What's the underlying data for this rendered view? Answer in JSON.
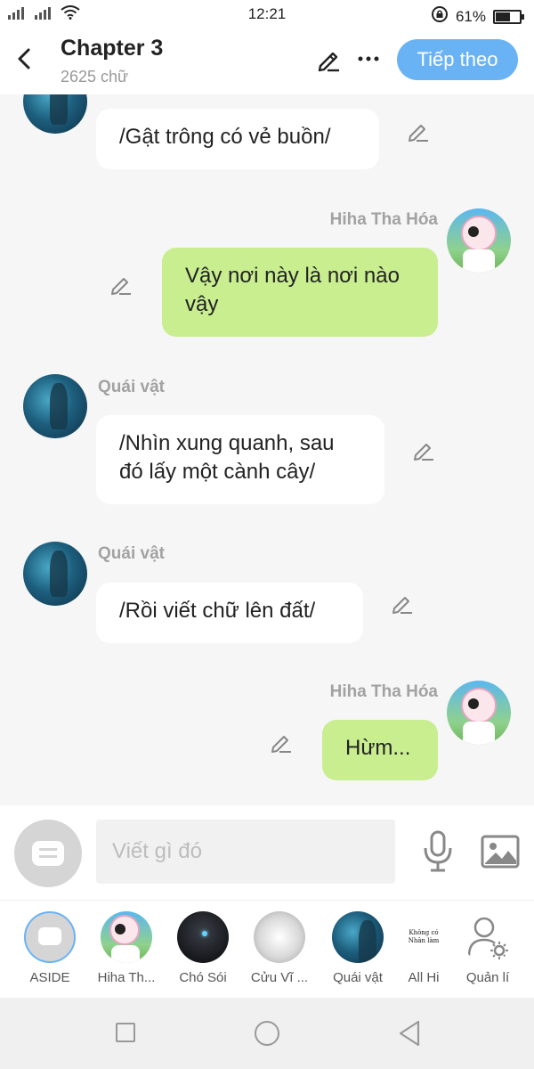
{
  "status": {
    "time": "12:21",
    "battery_text": "61%",
    "battery_level": 0.61,
    "left_icons": [
      "signal-icon",
      "signal-icon",
      "wifi-icon"
    ],
    "right_icons": [
      "rotation-lock-icon",
      "battery-icon"
    ]
  },
  "header": {
    "title": "Chapter 3",
    "subtitle": "2625 chữ",
    "next_label": "Tiếp theo",
    "icons": [
      "back-arrow-icon",
      "pencil-icon",
      "more-icon"
    ]
  },
  "messages": [
    {
      "side": "left",
      "speaker": "",
      "avatar": "monster-avatar",
      "text": "/Gật trông có vẻ buồn/"
    },
    {
      "side": "right",
      "speaker": "Hiha Tha Hóa",
      "avatar": "hiha-avatar",
      "text": "Vậy nơi này là nơi nào vậy"
    },
    {
      "side": "left",
      "speaker": "Quái vật",
      "avatar": "monster-avatar",
      "text": "/Nhìn xung quanh, sau đó lấy một cành cây/"
    },
    {
      "side": "left",
      "speaker": "Quái vật",
      "avatar": "monster-avatar",
      "text": "/Rồi viết chữ lên đất/"
    },
    {
      "side": "right",
      "speaker": "Hiha Tha Hóa",
      "avatar": "hiha-avatar",
      "text": "Hừm..."
    }
  ],
  "input": {
    "placeholder": "Viết gì đó",
    "icons": [
      "aside-icon",
      "microphone-icon",
      "image-icon"
    ]
  },
  "characters": [
    {
      "label": "ASIDE",
      "avatar": "aside-icon"
    },
    {
      "label": "Hiha Th...",
      "avatar": "hiha-avatar"
    },
    {
      "label": "Chó Sói",
      "avatar": "wolf-avatar"
    },
    {
      "label": "Cửu Vĩ ...",
      "avatar": "fox-avatar"
    },
    {
      "label": "Quái vật",
      "avatar": "monster-avatar"
    },
    {
      "label": "All Hi",
      "avatar": "text-avatar",
      "avatar_text": "Không có Nhân làm"
    },
    {
      "label": "Quản lí",
      "avatar": "manage-user-icon"
    }
  ],
  "navbar": {
    "icons": [
      "recent-apps-icon",
      "home-icon",
      "back-icon"
    ]
  },
  "colors": {
    "accent": "#69b3f5",
    "bubble_right": "#c8ee90",
    "bubble_left": "#ffffff",
    "background": "#f6f6f6"
  }
}
